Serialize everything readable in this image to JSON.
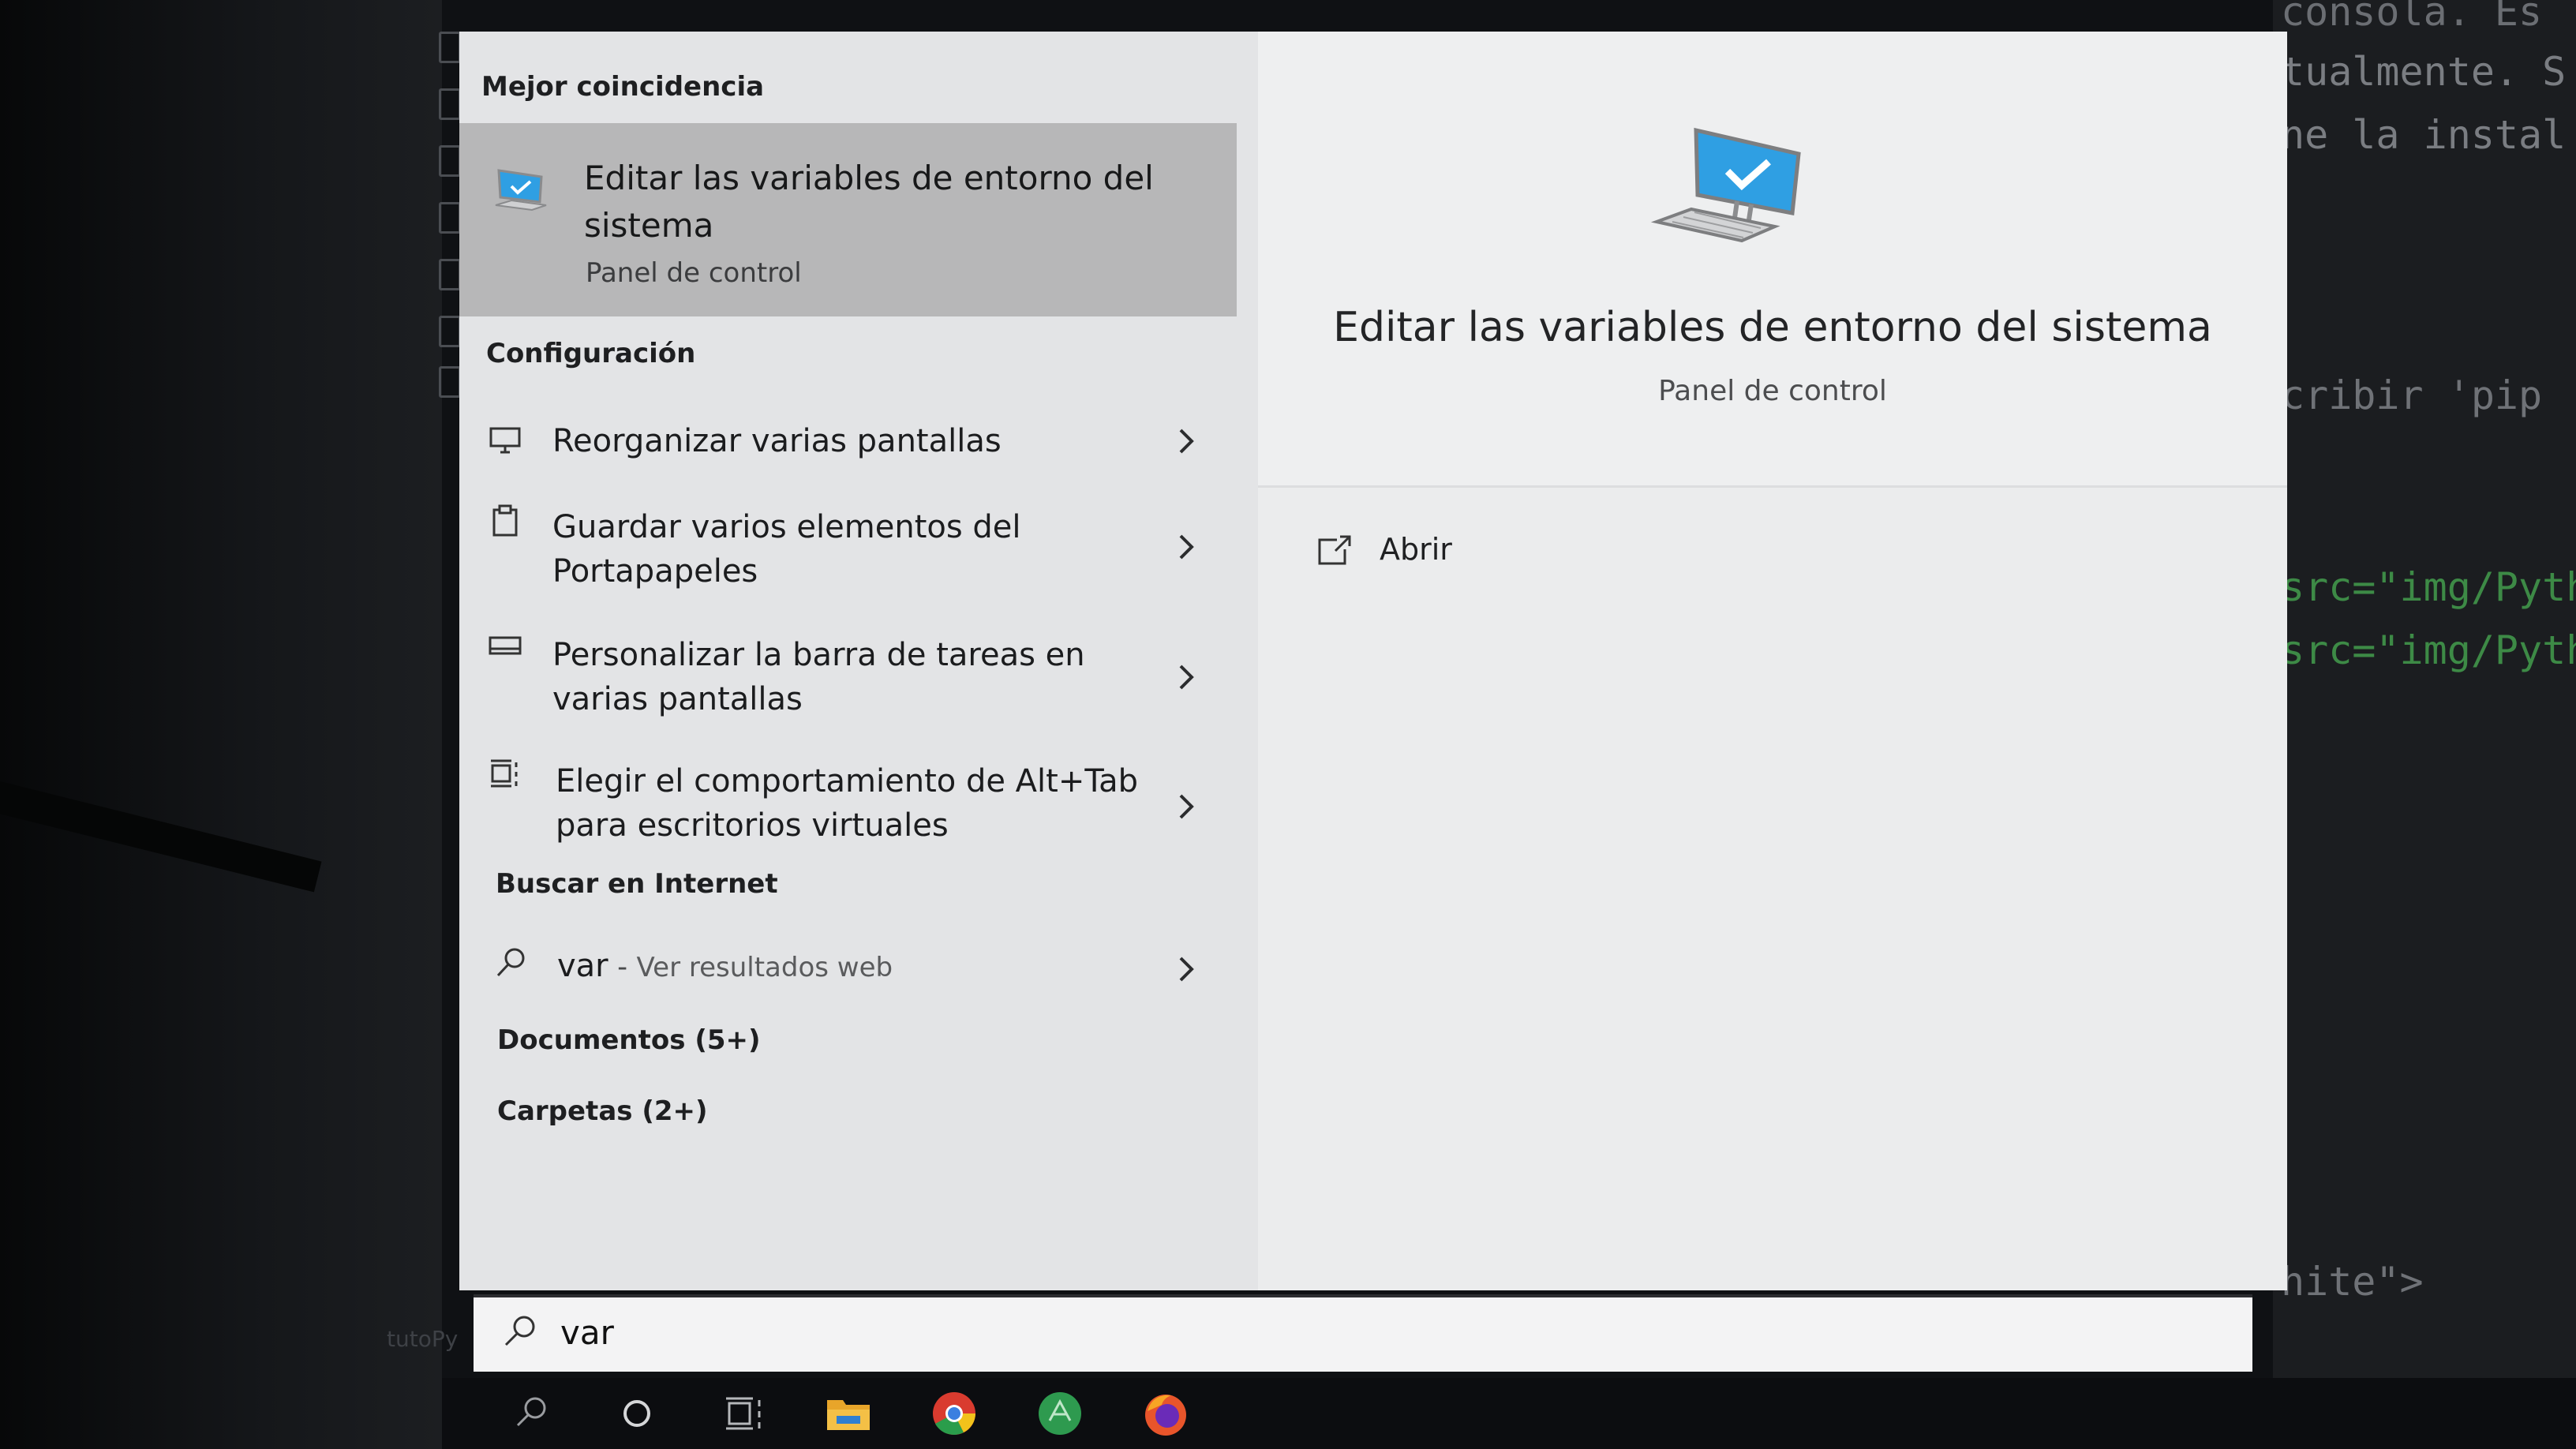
{
  "background_code": {
    "lines": [
      "consola. Es",
      "tualmente. S",
      "ne la instal",
      "cribir 'pip",
      "src=\"img/Pyth",
      "src=\"img/Pyth",
      "hite\">"
    ],
    "file_label": "tutoPy"
  },
  "menu": {
    "best_match": {
      "header": "Mejor coincidencia",
      "title": "Editar las variables de entorno del sistema",
      "subtitle": "Panel de control",
      "icon": "computer-check-icon"
    },
    "settings": {
      "header": "Configuración",
      "items": [
        {
          "label": "Reorganizar varias pantallas",
          "icon": "monitor-icon"
        },
        {
          "label": "Guardar varios elementos del Portapapeles",
          "icon": "clipboard-icon"
        },
        {
          "label": "Personalizar la barra de tareas en varias pantallas",
          "icon": "taskbar-icon"
        },
        {
          "label": "Elegir el comportamiento de Alt+Tab para escritorios virtuales",
          "icon": "task-view-icon"
        }
      ]
    },
    "web": {
      "header": "Buscar en Internet",
      "query": "var",
      "separator": " - ",
      "hint": "Ver resultados web"
    },
    "documents_label": "Documentos (5+)",
    "folders_label": "Carpetas (2+)"
  },
  "preview": {
    "title": "Editar las variables de entorno del sistema",
    "subtitle": "Panel de control",
    "action_label": "Abrir"
  },
  "search": {
    "value": "var"
  },
  "taskbar": {
    "icons": [
      "search-icon",
      "cortana-icon",
      "task-view-icon",
      "file-explorer-icon",
      "chrome-icon",
      "app-icon",
      "firefox-icon"
    ]
  },
  "colors": {
    "panel_bg": "#e6e7e9",
    "selected_bg": "#b7b7b8",
    "accent_blue": "#2f9fe3",
    "taskbar_bg": "#0c0d10"
  }
}
